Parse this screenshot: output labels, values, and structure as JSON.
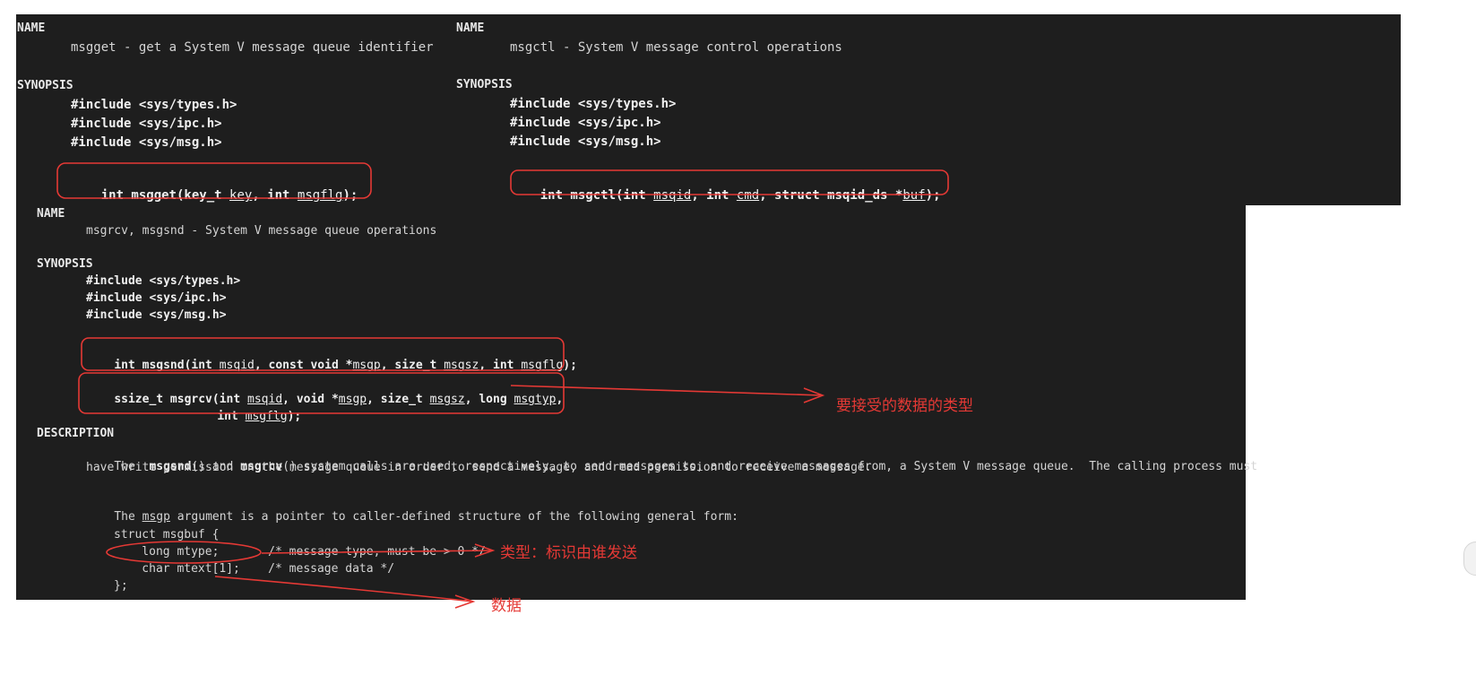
{
  "msgget_panel": {
    "name_header": "NAME",
    "name_line": "msgget - get a System V message queue identifier",
    "synopsis_header": "SYNOPSIS",
    "includes": [
      "#include <sys/types.h>",
      "#include <sys/ipc.h>",
      "#include <sys/msg.h>"
    ],
    "prototype": {
      "p1": "int msgget(key_t ",
      "arg1": "key",
      "p2": ", int ",
      "arg2": "msgflg",
      "p3": ");"
    }
  },
  "msgctl_panel": {
    "name_header": "NAME",
    "name_line": "msgctl - System V message control operations",
    "synopsis_header": "SYNOPSIS",
    "includes": [
      "#include <sys/types.h>",
      "#include <sys/ipc.h>",
      "#include <sys/msg.h>"
    ],
    "prototype": {
      "p1": "int msgctl(int ",
      "arg1": "msqid",
      "p2": ", int ",
      "arg2": "cmd",
      "p3": ", struct msqid_ds *",
      "arg3": "buf",
      "p4": ");"
    }
  },
  "msgsnd_panel": {
    "name_header": "NAME",
    "name_line": "msgrcv, msgsnd - System V message queue operations",
    "synopsis_header": "SYNOPSIS",
    "includes": [
      "#include <sys/types.h>",
      "#include <sys/ipc.h>",
      "#include <sys/msg.h>"
    ],
    "msgsnd": {
      "p1": "int msgsnd(int ",
      "arg1": "msqid",
      "p2": ", const void *",
      "arg2": "msgp",
      "p3": ", size_t ",
      "arg3": "msgsz",
      "p4": ", int ",
      "arg4": "msgflg",
      "p5": ");"
    },
    "msgrcv": {
      "p1": "ssize_t msgrcv(int ",
      "arg1": "msqid",
      "p2": ", void *",
      "arg2": "msgp",
      "p3": ", size_t ",
      "arg3": "msgsz",
      "p4": ", long ",
      "arg4": "msgtyp",
      "p5": ",",
      "l2p1": "int ",
      "l2arg": "msgflg",
      "l2p2": ");"
    },
    "description_header": "DESCRIPTION",
    "desc1": {
      "pre": "The  ",
      "f1": "msgsnd",
      "mid": "() and ",
      "f2": "msgrcv",
      "post": "() system calls are used, respectively, to send messages to, and receive messages from, a System V message queue.  The calling process must"
    },
    "desc2": "have write permission on the message queue in order to send a message, and read permission to receive a message.",
    "desc3": {
      "pre": "The ",
      "arg": "msgp",
      "post": " argument is a pointer to caller-defined structure of the following general form:"
    },
    "struct_lines": [
      "struct msgbuf {",
      "    long mtype;       /* message type, must be > 0 */",
      "    char mtext[1];    /* message data */",
      "};"
    ]
  },
  "annotations": {
    "msgtyp_note": "要接受的数据的类型",
    "mtype_note": "类型：标识由谁发送",
    "mtext_note": "数据",
    "color": "#e53935"
  },
  "colors": {
    "panel_bg": "#1e1e1e",
    "text": "#d4d4d4",
    "annotation_red": "#e53935"
  }
}
